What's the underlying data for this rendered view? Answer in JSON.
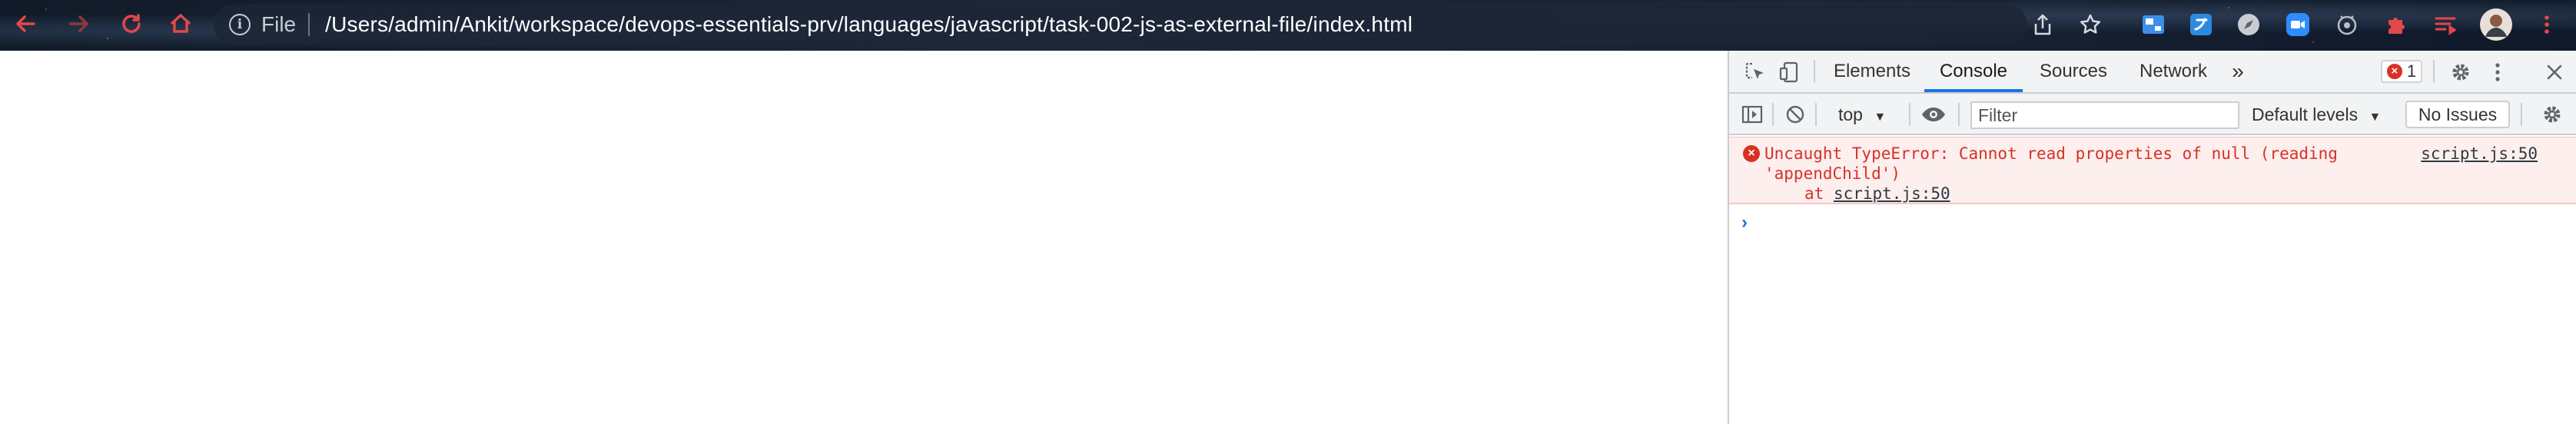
{
  "browser": {
    "url_scheme": "File",
    "url": "/Users/admin/Ankit/workspace/devops-essentials-prv/languages/javascript/task-002-js-as-external-file/index.html",
    "nav_icons": [
      "back-arrow-icon",
      "forward-arrow-icon",
      "reload-icon",
      "home-icon"
    ],
    "toolbar_icons": [
      "share-icon",
      "bookmark-star-icon",
      "extension-blue-icon",
      "extension-translate-icon",
      "extension-compass-icon",
      "zoom-video-icon",
      "extension-camera-icon",
      "puzzle-extensions-icon",
      "reading-list-icon",
      "profile-avatar",
      "kebab-menu-icon"
    ]
  },
  "devtools": {
    "tabs": [
      "Elements",
      "Console",
      "Sources",
      "Network"
    ],
    "active_tab": "Console",
    "more_tabs": "»",
    "error_count": "1",
    "context": "top",
    "filter_placeholder": "Filter",
    "levels": "Default levels",
    "issues": "No Issues"
  },
  "console": {
    "messages": [
      {
        "level": "error",
        "line1": "Uncaught TypeError: Cannot read properties of null (reading",
        "line2": "'appendChild')",
        "stack_prefix": "at ",
        "stack_location": "script.js:50",
        "source": "script.js:50"
      }
    ],
    "prompt": "›"
  },
  "colors": {
    "error_red": "#d93025",
    "devtools_bg": "#f1f3f4",
    "accent_blue": "#1a73e8"
  }
}
